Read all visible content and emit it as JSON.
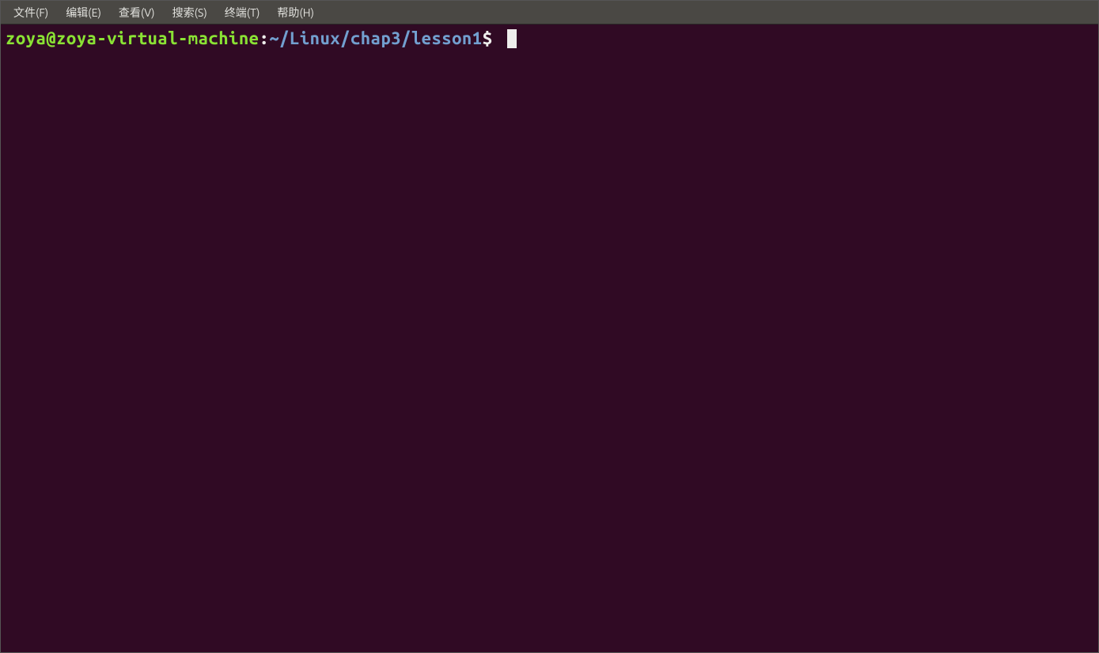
{
  "menu": {
    "items": [
      "文件(F)",
      "编辑(E)",
      "查看(V)",
      "搜索(S)",
      "终端(T)",
      "帮助(H)"
    ]
  },
  "terminal": {
    "prompt": {
      "user_host": "zoya@zoya-virtual-machine",
      "separator": ":",
      "path": "~/Linux/chap3/lesson1",
      "symbol": "$"
    }
  }
}
